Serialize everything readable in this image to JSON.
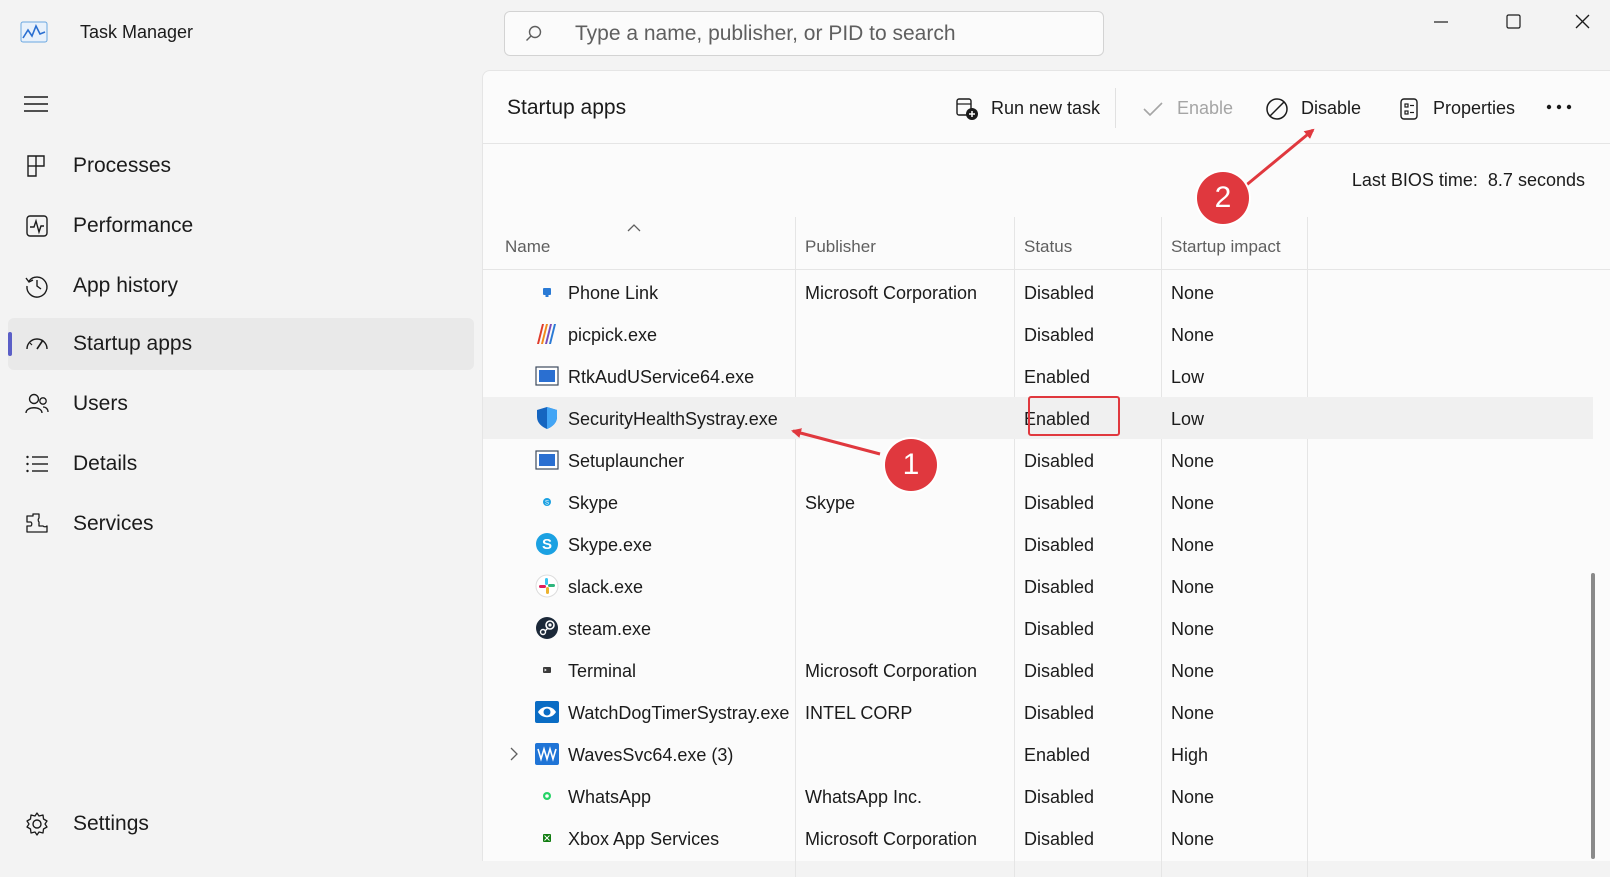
{
  "window": {
    "title": "Task Manager"
  },
  "search": {
    "placeholder": "Type a name, publisher, or PID to search"
  },
  "sidebar": {
    "items": [
      {
        "label": "Processes",
        "icon": "processes-icon",
        "active": false
      },
      {
        "label": "Performance",
        "icon": "performance-icon",
        "active": false
      },
      {
        "label": "App history",
        "icon": "app-history-icon",
        "active": false
      },
      {
        "label": "Startup apps",
        "icon": "startup-apps-icon",
        "active": true
      },
      {
        "label": "Users",
        "icon": "users-icon",
        "active": false
      },
      {
        "label": "Details",
        "icon": "details-icon",
        "active": false
      },
      {
        "label": "Services",
        "icon": "services-icon",
        "active": false
      }
    ],
    "settings_label": "Settings"
  },
  "main": {
    "title": "Startup apps",
    "toolbar": {
      "run_new_task": "Run new task",
      "enable": "Enable",
      "disable": "Disable",
      "properties": "Properties"
    },
    "bios_label": "Last BIOS time:",
    "bios_value": "8.7 seconds",
    "columns": {
      "name": "Name",
      "publisher": "Publisher",
      "status": "Status",
      "impact": "Startup impact"
    },
    "rows": [
      {
        "name": "Phone Link",
        "publisher": "Microsoft Corporation",
        "status": "Disabled",
        "impact": "None",
        "icon": "phone-link-icon"
      },
      {
        "name": "picpick.exe",
        "publisher": "",
        "status": "Disabled",
        "impact": "None",
        "icon": "picpick-icon"
      },
      {
        "name": "RtkAudUService64.exe",
        "publisher": "",
        "status": "Enabled",
        "impact": "Low",
        "icon": "app-window-icon"
      },
      {
        "name": "SecurityHealthSystray.exe",
        "publisher": "",
        "status": "Enabled",
        "impact": "Low",
        "icon": "shield-icon"
      },
      {
        "name": "Setuplauncher",
        "publisher": "",
        "status": "Disabled",
        "impact": "None",
        "icon": "app-window-icon"
      },
      {
        "name": "Skype",
        "publisher": "Skype",
        "status": "Disabled",
        "impact": "None",
        "icon": "skype-small-icon"
      },
      {
        "name": "Skype.exe",
        "publisher": "",
        "status": "Disabled",
        "impact": "None",
        "icon": "skype-icon"
      },
      {
        "name": "slack.exe",
        "publisher": "",
        "status": "Disabled",
        "impact": "None",
        "icon": "slack-icon"
      },
      {
        "name": "steam.exe",
        "publisher": "",
        "status": "Disabled",
        "impact": "None",
        "icon": "steam-icon"
      },
      {
        "name": "Terminal",
        "publisher": "Microsoft Corporation",
        "status": "Disabled",
        "impact": "None",
        "icon": "terminal-icon"
      },
      {
        "name": "WatchDogTimerSystray.exe",
        "publisher": "INTEL CORP",
        "status": "Disabled",
        "impact": "None",
        "icon": "eye-icon"
      },
      {
        "name": "WavesSvc64.exe (3)",
        "publisher": "",
        "status": "Enabled",
        "impact": "High",
        "icon": "waves-icon"
      },
      {
        "name": "WhatsApp",
        "publisher": "WhatsApp Inc.",
        "status": "Disabled",
        "impact": "None",
        "icon": "whatsapp-icon"
      },
      {
        "name": "Xbox App Services",
        "publisher": "Microsoft Corporation",
        "status": "Disabled",
        "impact": "None",
        "icon": "xbox-icon"
      }
    ]
  },
  "annotations": {
    "badge_1": "1",
    "badge_2": "2"
  },
  "colors": {
    "accent": "#5b5fc7",
    "annotation_red": "#e0383e"
  }
}
